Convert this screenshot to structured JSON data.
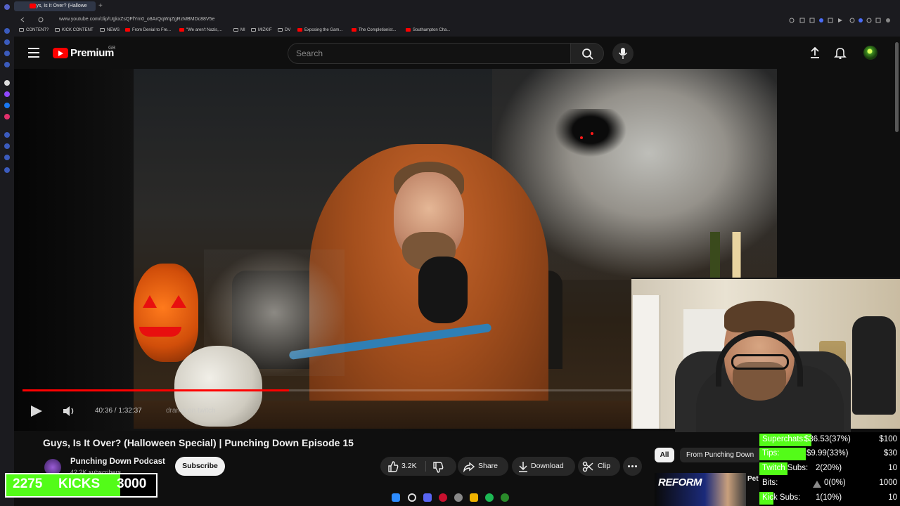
{
  "browser": {
    "tab_title": "Guys, Is It Over? (Hallowe",
    "url": "www.youtube.com/clip/UgkxZsQFfYm0_o8ArQqWqZgRzMBMDc88V5e",
    "bookmarks": [
      "CONTENT?",
      "KICK CONTENT",
      "NEWS",
      "From Denial to Fre...",
      "\"We aren't Nazis,...",
      "MI",
      "MIZKIF",
      "DV",
      "Exposing the Gam...",
      "The Completionist...",
      "Southampton Cha..."
    ]
  },
  "masthead": {
    "logo_text": "Premium",
    "logo_region": "GB",
    "search_placeholder": "Search"
  },
  "player": {
    "current_time": "40:36",
    "separator": " / ",
    "duration": "1:32:37",
    "chapter_text": "drama on twitch",
    "progress_fraction": 0.438
  },
  "video": {
    "title": "Guys, Is It Over? (Halloween Special) | Punching Down Episode 15",
    "channel_name": "Punching Down Podcast",
    "channel_subs": "42.2K subscribers",
    "subscribe_label": "Subscribe",
    "like_count": "3.2K",
    "share_label": "Share",
    "download_label": "Download",
    "clip_label": "Clip"
  },
  "recommendations": {
    "chip_all": "All",
    "chip_from": "From Punching Down",
    "thumb_text": "REFORM",
    "title_fragment": "Pet"
  },
  "overlay_kicks": {
    "count": "2275",
    "label": "KICKS",
    "goal": "3000",
    "fill_fraction": 0.76
  },
  "overlay_stats": [
    {
      "label": "Superchats:",
      "value": "$36.53(37%)",
      "goal": "$100",
      "fill_fraction": 0.37
    },
    {
      "label": "Tips:",
      "value": "$9.99(33%)",
      "goal": "$30",
      "fill_fraction": 0.33
    },
    {
      "label": "Twitch Subs:",
      "value": "2(20%)",
      "goal": "10",
      "fill_fraction": 0.2
    },
    {
      "label": "Bits:",
      "value": "0(0%)",
      "goal": "1000",
      "fill_fraction": 0.0
    },
    {
      "label": "Kick Subs:",
      "value": "1(10%)",
      "goal": "10",
      "fill_fraction": 0.1
    }
  ],
  "colors": {
    "youtube_red": "#ff0000",
    "kick_green": "#53fc18",
    "background": "#0f0f0f"
  }
}
